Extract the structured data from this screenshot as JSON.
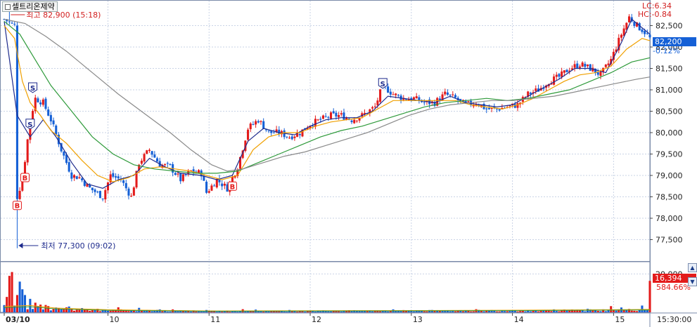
{
  "readouts": {
    "lc": "LC:6.34",
    "hc": "HC:-0.84",
    "current_price": "82,200",
    "change_pct": "-0.12%",
    "current_volume": "16,394",
    "volume_ratio": "584.66%"
  },
  "colors": {
    "up": "#e31b1b",
    "down": "#1560d6",
    "ma_short": "#1d2a8c",
    "ma_mid": "#f0a000",
    "ma_long": "#2e9a3a",
    "ma_longest": "#8a8a8a",
    "grid": "#c9d3e6"
  },
  "chart_data": {
    "type": "candlestick",
    "title": "셀트리온제약",
    "price_axis": {
      "ylim": [
        77000,
        83000
      ],
      "ticks": [
        "82,500",
        "82,000",
        "81,500",
        "81,000",
        "80,500",
        "80,000",
        "79,500",
        "79,000",
        "78,500",
        "78,000",
        "77,500"
      ],
      "tick_values": [
        82500,
        82000,
        81500,
        81000,
        80500,
        80000,
        79500,
        79000,
        78500,
        78000,
        77500
      ]
    },
    "volume_axis": {
      "ticks": [
        "20,000"
      ],
      "tick_values": [
        20000
      ],
      "ylim": [
        0,
        26000
      ]
    },
    "x_labels": [
      {
        "label": "03/10",
        "index": 0
      },
      {
        "label": "10",
        "index": 40
      },
      {
        "label": "11",
        "index": 79
      },
      {
        "label": "12",
        "index": 118
      },
      {
        "label": "13",
        "index": 157
      },
      {
        "label": "14",
        "index": 196
      },
      {
        "label": "15",
        "index": 235
      }
    ],
    "x_end_label": "15:30:00",
    "annotations": [
      {
        "text": "최고 82,900 (15:18)",
        "index": 2,
        "value": 82900,
        "side": "top"
      },
      {
        "text": "최저 77,300 (09:02)",
        "index": 5,
        "value": 77300,
        "side": "bottom"
      }
    ],
    "signals": [
      {
        "label": "S",
        "index": 11,
        "value": 81050
      },
      {
        "label": "S",
        "index": 10,
        "value": 80200
      },
      {
        "label": "B",
        "index": 8,
        "value": 78950
      },
      {
        "label": "B",
        "index": 5,
        "value": 78300
      },
      {
        "label": "B",
        "index": 88,
        "value": 78750
      },
      {
        "label": "S",
        "index": 146,
        "value": 81150
      }
    ],
    "series": [
      {
        "name": "",
        "role": "price_path",
        "points": [
          [
            0,
            82650
          ],
          [
            4,
            82500
          ],
          [
            5,
            78500
          ],
          [
            7,
            78900
          ],
          [
            10,
            80300
          ],
          [
            12,
            80800
          ],
          [
            15,
            80700
          ],
          [
            18,
            80300
          ],
          [
            22,
            79600
          ],
          [
            26,
            79000
          ],
          [
            29,
            78950
          ],
          [
            33,
            78700
          ],
          [
            38,
            78500
          ],
          [
            41,
            79000
          ],
          [
            45,
            78900
          ],
          [
            49,
            78500
          ],
          [
            52,
            79300
          ],
          [
            56,
            79600
          ],
          [
            60,
            79250
          ],
          [
            64,
            79200
          ],
          [
            68,
            78900
          ],
          [
            72,
            79100
          ],
          [
            76,
            79050
          ],
          [
            78,
            78600
          ],
          [
            82,
            78900
          ],
          [
            86,
            78700
          ],
          [
            90,
            79200
          ],
          [
            94,
            80100
          ],
          [
            98,
            80300
          ],
          [
            102,
            80000
          ],
          [
            106,
            80000
          ],
          [
            110,
            79900
          ],
          [
            114,
            80000
          ],
          [
            118,
            80200
          ],
          [
            122,
            80300
          ],
          [
            126,
            80400
          ],
          [
            130,
            80400
          ],
          [
            134,
            80300
          ],
          [
            138,
            80400
          ],
          [
            143,
            80600
          ],
          [
            146,
            81100
          ],
          [
            150,
            80900
          ],
          [
            154,
            80800
          ],
          [
            158,
            80800
          ],
          [
            162,
            80700
          ],
          [
            166,
            80700
          ],
          [
            170,
            80900
          ],
          [
            174,
            80800
          ],
          [
            178,
            80650
          ],
          [
            182,
            80700
          ],
          [
            186,
            80550
          ],
          [
            190,
            80550
          ],
          [
            194,
            80600
          ],
          [
            198,
            80650
          ],
          [
            202,
            80900
          ],
          [
            206,
            81000
          ],
          [
            210,
            81200
          ],
          [
            214,
            81300
          ],
          [
            218,
            81500
          ],
          [
            222,
            81600
          ],
          [
            226,
            81500
          ],
          [
            230,
            81350
          ],
          [
            234,
            81700
          ],
          [
            238,
            82300
          ],
          [
            241,
            82700
          ],
          [
            244,
            82500
          ],
          [
            247,
            82350
          ],
          [
            249,
            82200
          ]
        ]
      },
      {
        "name": "",
        "role": "ma_short",
        "points": [
          [
            0,
            82600
          ],
          [
            5,
            80400
          ],
          [
            10,
            79900
          ],
          [
            15,
            80300
          ],
          [
            20,
            79900
          ],
          [
            26,
            79300
          ],
          [
            32,
            78800
          ],
          [
            38,
            78700
          ],
          [
            44,
            78900
          ],
          [
            50,
            79000
          ],
          [
            56,
            79400
          ],
          [
            62,
            79200
          ],
          [
            68,
            79050
          ],
          [
            76,
            79000
          ],
          [
            82,
            78900
          ],
          [
            88,
            79000
          ],
          [
            94,
            79800
          ],
          [
            100,
            80100
          ],
          [
            106,
            80000
          ],
          [
            112,
            79950
          ],
          [
            118,
            80150
          ],
          [
            124,
            80300
          ],
          [
            130,
            80350
          ],
          [
            136,
            80350
          ],
          [
            142,
            80500
          ],
          [
            148,
            80850
          ],
          [
            154,
            80800
          ],
          [
            160,
            80750
          ],
          [
            166,
            80700
          ],
          [
            172,
            80850
          ],
          [
            178,
            80700
          ],
          [
            184,
            80650
          ],
          [
            190,
            80600
          ],
          [
            196,
            80650
          ],
          [
            202,
            80850
          ],
          [
            208,
            81050
          ],
          [
            214,
            81250
          ],
          [
            220,
            81500
          ],
          [
            226,
            81500
          ],
          [
            232,
            81400
          ],
          [
            238,
            82100
          ],
          [
            242,
            82650
          ],
          [
            246,
            82450
          ],
          [
            249,
            82300
          ]
        ]
      },
      {
        "name": "",
        "role": "ma_mid",
        "points": [
          [
            0,
            82500
          ],
          [
            4,
            82200
          ],
          [
            7,
            81200
          ],
          [
            10,
            80700
          ],
          [
            14,
            80400
          ],
          [
            18,
            80050
          ],
          [
            24,
            79750
          ],
          [
            30,
            79350
          ],
          [
            36,
            79000
          ],
          [
            42,
            78850
          ],
          [
            48,
            78950
          ],
          [
            54,
            79150
          ],
          [
            60,
            79200
          ],
          [
            66,
            79150
          ],
          [
            72,
            79100
          ],
          [
            78,
            79000
          ],
          [
            84,
            78900
          ],
          [
            90,
            79000
          ],
          [
            96,
            79600
          ],
          [
            102,
            79900
          ],
          [
            108,
            80000
          ],
          [
            114,
            80000
          ],
          [
            120,
            80150
          ],
          [
            126,
            80250
          ],
          [
            132,
            80300
          ],
          [
            138,
            80350
          ],
          [
            144,
            80550
          ],
          [
            150,
            80750
          ],
          [
            156,
            80750
          ],
          [
            162,
            80750
          ],
          [
            168,
            80750
          ],
          [
            174,
            80750
          ],
          [
            180,
            80650
          ],
          [
            186,
            80600
          ],
          [
            192,
            80550
          ],
          [
            198,
            80650
          ],
          [
            204,
            80800
          ],
          [
            210,
            81000
          ],
          [
            216,
            81200
          ],
          [
            222,
            81350
          ],
          [
            228,
            81400
          ],
          [
            234,
            81550
          ],
          [
            240,
            81950
          ],
          [
            246,
            82200
          ],
          [
            249,
            82150
          ]
        ]
      },
      {
        "name": "",
        "role": "ma_long",
        "points": [
          [
            0,
            82600
          ],
          [
            6,
            82300
          ],
          [
            12,
            81700
          ],
          [
            18,
            81100
          ],
          [
            26,
            80500
          ],
          [
            34,
            79900
          ],
          [
            42,
            79500
          ],
          [
            50,
            79250
          ],
          [
            58,
            79150
          ],
          [
            66,
            79100
          ],
          [
            74,
            79050
          ],
          [
            82,
            79050
          ],
          [
            90,
            79100
          ],
          [
            98,
            79300
          ],
          [
            106,
            79500
          ],
          [
            114,
            79700
          ],
          [
            122,
            79900
          ],
          [
            130,
            80050
          ],
          [
            138,
            80150
          ],
          [
            146,
            80300
          ],
          [
            154,
            80450
          ],
          [
            162,
            80600
          ],
          [
            170,
            80700
          ],
          [
            178,
            80750
          ],
          [
            186,
            80800
          ],
          [
            194,
            80750
          ],
          [
            202,
            80800
          ],
          [
            210,
            80900
          ],
          [
            218,
            81000
          ],
          [
            226,
            81200
          ],
          [
            234,
            81400
          ],
          [
            242,
            81650
          ],
          [
            249,
            81750
          ]
        ]
      },
      {
        "name": "",
        "role": "ma_longest",
        "points": [
          [
            0,
            82650
          ],
          [
            8,
            82550
          ],
          [
            16,
            82250
          ],
          [
            24,
            81900
          ],
          [
            34,
            81400
          ],
          [
            44,
            80900
          ],
          [
            54,
            80450
          ],
          [
            64,
            80000
          ],
          [
            72,
            79600
          ],
          [
            80,
            79250
          ],
          [
            86,
            79100
          ],
          [
            92,
            79150
          ],
          [
            100,
            79300
          ],
          [
            108,
            79450
          ],
          [
            116,
            79550
          ],
          [
            124,
            79700
          ],
          [
            132,
            79850
          ],
          [
            140,
            80000
          ],
          [
            148,
            80200
          ],
          [
            156,
            80400
          ],
          [
            164,
            80550
          ],
          [
            172,
            80650
          ],
          [
            180,
            80700
          ],
          [
            188,
            80750
          ],
          [
            196,
            80750
          ],
          [
            204,
            80800
          ],
          [
            212,
            80850
          ],
          [
            220,
            80950
          ],
          [
            228,
            81050
          ],
          [
            236,
            81150
          ],
          [
            244,
            81250
          ],
          [
            249,
            81300
          ]
        ]
      }
    ],
    "volume_baseline": [
      [
        0,
        3000
      ],
      [
        10,
        3600
      ],
      [
        20,
        2200
      ],
      [
        40,
        1300
      ],
      [
        80,
        700
      ],
      [
        120,
        800
      ],
      [
        160,
        900
      ],
      [
        200,
        1100
      ],
      [
        240,
        1400
      ],
      [
        249,
        1500
      ]
    ],
    "volume_spikes": [
      [
        1,
        8000
      ],
      [
        2,
        19000
      ],
      [
        3,
        21000
      ],
      [
        5,
        9000
      ],
      [
        6,
        16000
      ],
      [
        7,
        12000
      ],
      [
        8,
        9000
      ],
      [
        10,
        7000
      ],
      [
        12,
        5000
      ],
      [
        14,
        4000
      ],
      [
        16,
        3800
      ],
      [
        20,
        2500
      ],
      [
        25,
        3000
      ],
      [
        30,
        2200
      ],
      [
        36,
        1800
      ],
      [
        44,
        2600
      ],
      [
        52,
        2300
      ],
      [
        60,
        1500
      ],
      [
        65,
        1500
      ],
      [
        78,
        1200
      ],
      [
        92,
        1600
      ],
      [
        97,
        1400
      ],
      [
        110,
        1200
      ],
      [
        150,
        1500
      ],
      [
        182,
        1600
      ],
      [
        225,
        1800
      ],
      [
        234,
        3200
      ],
      [
        238,
        2500
      ],
      [
        246,
        3500
      ],
      [
        249,
        16394
      ]
    ]
  }
}
